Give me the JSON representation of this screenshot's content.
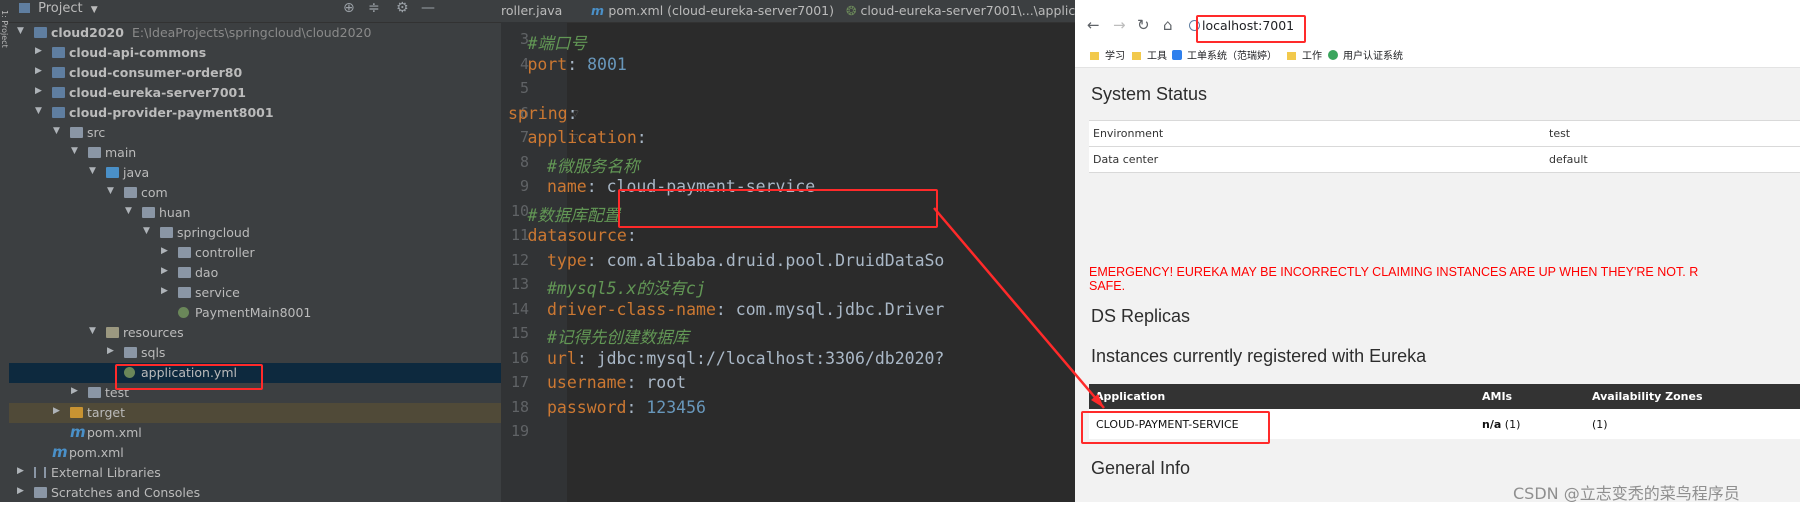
{
  "project": {
    "header_label": "Project",
    "side_label": "1: Project",
    "tree": [
      {
        "label": "cloud2020",
        "path": "E:\\IdeaProjects\\springcloud\\cloud2020",
        "bold": true,
        "depth": 0,
        "icon": "module-folder-icon",
        "arrow": "▼"
      },
      {
        "label": "cloud-api-commons",
        "bold": true,
        "depth": 1,
        "icon": "module-folder-icon",
        "arrow": "▶"
      },
      {
        "label": "cloud-consumer-order80",
        "bold": true,
        "depth": 1,
        "icon": "module-folder-icon",
        "arrow": "▶"
      },
      {
        "label": "cloud-eureka-server7001",
        "bold": true,
        "depth": 1,
        "icon": "module-folder-icon",
        "arrow": "▶"
      },
      {
        "label": "cloud-provider-payment8001",
        "bold": true,
        "depth": 1,
        "icon": "module-folder-icon",
        "arrow": "▼"
      },
      {
        "label": "src",
        "depth": 2,
        "icon": "folder-icon",
        "arrow": "▼"
      },
      {
        "label": "main",
        "depth": 3,
        "icon": "folder-icon",
        "arrow": "▼"
      },
      {
        "label": "java",
        "depth": 4,
        "icon": "source-folder-icon",
        "arrow": "▼"
      },
      {
        "label": "com",
        "depth": 5,
        "icon": "package-icon",
        "arrow": "▼"
      },
      {
        "label": "huan",
        "depth": 6,
        "icon": "package-icon",
        "arrow": "▼"
      },
      {
        "label": "springcloud",
        "depth": 7,
        "icon": "package-icon",
        "arrow": "▼"
      },
      {
        "label": "controller",
        "depth": 8,
        "icon": "package-icon",
        "arrow": "▶"
      },
      {
        "label": "dao",
        "depth": 8,
        "icon": "package-icon",
        "arrow": "▶"
      },
      {
        "label": "service",
        "depth": 8,
        "icon": "package-icon",
        "arrow": "▶"
      },
      {
        "label": "PaymentMain8001",
        "depth": 8,
        "icon": "spring-boot-class-icon",
        "arrow": ""
      },
      {
        "label": "resources",
        "depth": 4,
        "icon": "resources-folder-icon",
        "arrow": "▼"
      },
      {
        "label": "sqls",
        "depth": 5,
        "icon": "folder-icon",
        "arrow": "▶"
      },
      {
        "label": "application.yml",
        "depth": 5,
        "icon": "yaml-file-icon",
        "arrow": "",
        "selected": true
      },
      {
        "label": "test",
        "depth": 3,
        "icon": "folder-icon",
        "arrow": "▶"
      },
      {
        "label": "target",
        "depth": 2,
        "icon": "target-folder-icon",
        "arrow": "▶",
        "excluded": true
      },
      {
        "label": "pom.xml",
        "depth": 2,
        "icon": "maven-file-icon",
        "arrow": ""
      },
      {
        "label": "pom.xml",
        "depth": 1,
        "icon": "maven-file-icon",
        "arrow": ""
      },
      {
        "label": "External Libraries",
        "depth": 0,
        "icon": "library-icon",
        "arrow": "▶"
      },
      {
        "label": "Scratches and Consoles",
        "depth": 0,
        "icon": "scratches-icon",
        "arrow": "▶"
      }
    ]
  },
  "editor": {
    "tabs": [
      {
        "label": "roller.java",
        "icon": ""
      },
      {
        "label": "pom.xml (cloud-eureka-server7001)",
        "icon": "maven-file-icon"
      },
      {
        "label": "cloud-eureka-server7001\\...\\applica",
        "icon": "spring-config-icon"
      }
    ],
    "lines": [
      {
        "num": "3",
        "indent": 1,
        "parts": [
          {
            "t": "#端口号",
            "c": "c"
          }
        ]
      },
      {
        "num": "4",
        "indent": 1,
        "parts": [
          {
            "t": "port",
            "c": "k"
          },
          {
            "t": ": ",
            "c": "v"
          },
          {
            "t": "8001",
            "c": "n"
          }
        ]
      },
      {
        "num": "5",
        "indent": 0,
        "parts": []
      },
      {
        "num": "6",
        "indent": 0,
        "parts": [
          {
            "t": "spring",
            "c": "k"
          },
          {
            "t": ":",
            "c": "v"
          }
        ]
      },
      {
        "num": "7",
        "indent": 1,
        "parts": [
          {
            "t": "application",
            "c": "k"
          },
          {
            "t": ":",
            "c": "v"
          }
        ]
      },
      {
        "num": "8",
        "indent": 2,
        "parts": [
          {
            "t": "#微服务名称",
            "c": "c"
          }
        ]
      },
      {
        "num": "9",
        "indent": 2,
        "parts": [
          {
            "t": "name",
            "c": "k"
          },
          {
            "t": ": cloud-payment-service",
            "c": "v"
          }
        ]
      },
      {
        "num": "10",
        "indent": 1,
        "parts": [
          {
            "t": "#数据库配置",
            "c": "c"
          }
        ]
      },
      {
        "num": "11",
        "indent": 1,
        "parts": [
          {
            "t": "datasource",
            "c": "k"
          },
          {
            "t": ":",
            "c": "v"
          }
        ]
      },
      {
        "num": "12",
        "indent": 2,
        "parts": [
          {
            "t": "type",
            "c": "k"
          },
          {
            "t": ": com.alibaba.druid.pool.DruidDataSo",
            "c": "v"
          }
        ]
      },
      {
        "num": "13",
        "indent": 2,
        "parts": [
          {
            "t": "#mysql5.x的没有cj",
            "c": "c"
          }
        ]
      },
      {
        "num": "14",
        "indent": 2,
        "parts": [
          {
            "t": "driver-class-name",
            "c": "k"
          },
          {
            "t": ": com.mysql.jdbc.Driver",
            "c": "v"
          }
        ]
      },
      {
        "num": "15",
        "indent": 2,
        "parts": [
          {
            "t": "#记得先创建数据库",
            "c": "c"
          }
        ]
      },
      {
        "num": "16",
        "indent": 2,
        "parts": [
          {
            "t": "url",
            "c": "k"
          },
          {
            "t": ": jdbc:mysql://localhost:3306/db2020?",
            "c": "v"
          }
        ]
      },
      {
        "num": "17",
        "indent": 2,
        "parts": [
          {
            "t": "username",
            "c": "k"
          },
          {
            "t": ": root",
            "c": "v"
          }
        ]
      },
      {
        "num": "18",
        "indent": 2,
        "parts": [
          {
            "t": "password",
            "c": "k"
          },
          {
            "t": ": ",
            "c": "v"
          },
          {
            "t": "123456",
            "c": "n"
          }
        ]
      },
      {
        "num": "19",
        "indent": 0,
        "parts": []
      }
    ]
  },
  "browser": {
    "url": "localhost:7001",
    "bookmarks": [
      {
        "label": "学习",
        "icon": "folder-icon"
      },
      {
        "label": "工具",
        "icon": "folder-icon"
      },
      {
        "label": "工单系统（范瑞婷）",
        "icon": "user-icon"
      },
      {
        "label": "工作",
        "icon": "folder-icon"
      },
      {
        "label": "用户认证系统",
        "icon": "globe-icon"
      }
    ],
    "system_status_title": "System Status",
    "status_rows": [
      {
        "key": "Environment",
        "value": "test"
      },
      {
        "key": "Data center",
        "value": "default"
      }
    ],
    "emergency_line1": "EMERGENCY! EUREKA MAY BE INCORRECTLY CLAIMING INSTANCES ARE UP WHEN THEY'RE NOT. R",
    "emergency_line2": "SAFE.",
    "ds_replicas_title": "DS Replicas",
    "instances_title": "Instances currently registered with Eureka",
    "instances_headers": [
      "Application",
      "AMIs",
      "Availability Zones"
    ],
    "instances": [
      {
        "application": "CLOUD-PAYMENT-SERVICE",
        "amis": "n/a",
        "amis_count": "(1)",
        "zones": "(1)"
      }
    ],
    "general_info_title": "General Info"
  },
  "watermark": "CSDN @立志变秃的菜鸟程序员",
  "colors": {
    "highlight": "#ff2a2a"
  }
}
